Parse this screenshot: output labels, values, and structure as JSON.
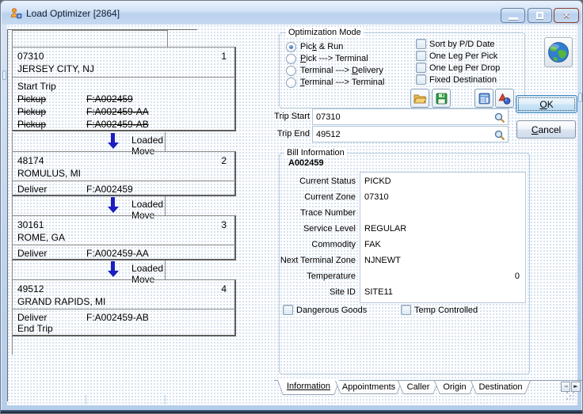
{
  "window": {
    "title": "Load Optimizer [2864]"
  },
  "itinerary": {
    "move_label": "Loaded Move",
    "stops": [
      {
        "zone": "07310",
        "city": "JERSEY CITY, NJ",
        "seq": "1",
        "lines": [
          {
            "action": "Start Trip",
            "bill": ""
          },
          {
            "action": "Pickup",
            "bill": "F:A002459"
          },
          {
            "action": "Pickup",
            "bill": "F:A002459-AA"
          },
          {
            "action": "Pickup",
            "bill": "F:A002459-AB"
          }
        ]
      },
      {
        "zone": "48174",
        "city": "ROMULUS, MI",
        "seq": "2",
        "lines": [
          {
            "action": "Deliver",
            "bill": "F:A002459"
          }
        ]
      },
      {
        "zone": "30161",
        "city": "ROME, GA",
        "seq": "3",
        "lines": [
          {
            "action": "Deliver",
            "bill": "F:A002459-AA"
          }
        ]
      },
      {
        "zone": "49512",
        "city": "GRAND RAPIDS, MI",
        "seq": "4",
        "lines": [
          {
            "action": "Deliver",
            "bill": "F:A002459-AB"
          },
          {
            "action": "End Trip",
            "bill": ""
          }
        ]
      }
    ]
  },
  "optimization": {
    "title": "Optimization Mode",
    "radios": [
      {
        "pre": "Pic",
        "key": "k",
        "post": " & Run",
        "selected": true
      },
      {
        "pre": "",
        "key": "P",
        "post": "ick ---> Terminal",
        "selected": false
      },
      {
        "pre": "Terminal ---> ",
        "key": "D",
        "post": "elivery",
        "selected": false
      },
      {
        "pre": "",
        "key": "T",
        "post": "erminal ---> Terminal",
        "selected": false
      }
    ],
    "checkboxes": [
      {
        "label": "Sort by P/D Date",
        "checked": false
      },
      {
        "label": "One Leg Per Pick",
        "checked": false
      },
      {
        "label": "One Leg Per Drop",
        "checked": false
      },
      {
        "label": "Fixed Destination",
        "checked": false
      }
    ]
  },
  "trip": {
    "start_label": "Trip Start",
    "start_value": "07310",
    "end_label": "Trip End",
    "end_value": "49512"
  },
  "bill": {
    "title": "Bill Information",
    "bill_number": "A002459",
    "fields": [
      {
        "label": "Current Status",
        "value": "PICKD"
      },
      {
        "label": "Current Zone",
        "value": "07310"
      },
      {
        "label": "Trace Number",
        "value": ""
      },
      {
        "label": "Service Level",
        "value": "REGULAR"
      },
      {
        "label": "Commodity",
        "value": "FAK"
      },
      {
        "label": "Next Terminal Zone",
        "value": "NJNEWT"
      },
      {
        "label": "Temperature",
        "value": "",
        "right_value": "0"
      },
      {
        "label": "Site ID",
        "value": "SITE11"
      }
    ],
    "checkboxes": [
      {
        "label": "Dangerous Goods",
        "checked": false
      },
      {
        "label": "Temp Controlled",
        "checked": false
      }
    ]
  },
  "tabs": {
    "items": [
      "Information",
      "Appointments",
      "Caller",
      "Origin",
      "Destination"
    ],
    "active": "Information"
  },
  "actions": {
    "ok": {
      "pre": "",
      "key": "O",
      "post": "K"
    },
    "cancel": {
      "pre": "",
      "key": "C",
      "post": "ancel"
    }
  },
  "colors": {
    "arrow_navy": "#1a1ec0",
    "close_red": "#cf4a2d",
    "globe_blue": "#2f7ed0",
    "globe_green": "#55b53c"
  }
}
